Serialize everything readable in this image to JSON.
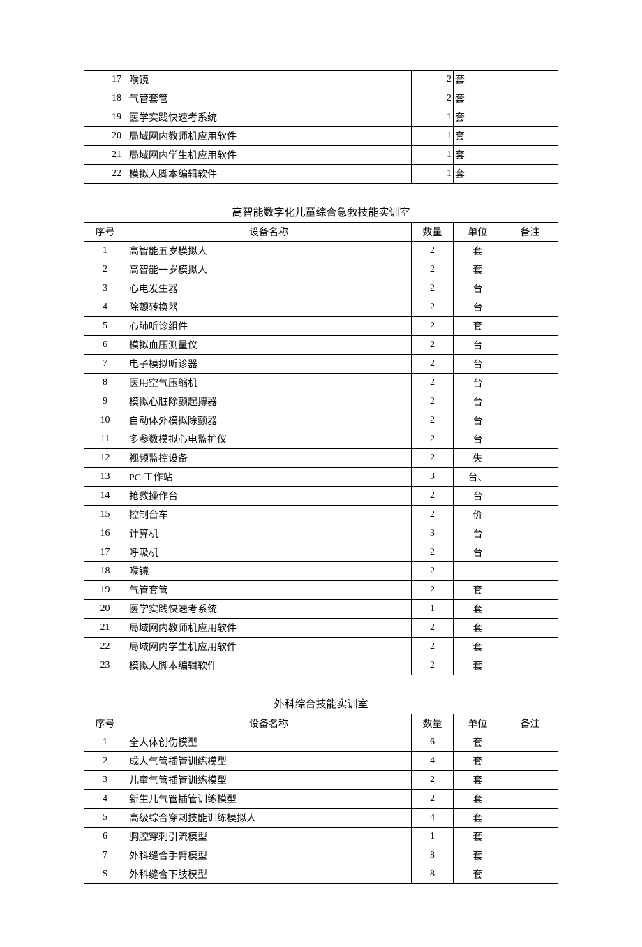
{
  "table1": {
    "rows": [
      {
        "seq": "17",
        "name": "喉镜",
        "qty": "2",
        "unit": "套",
        "note": ""
      },
      {
        "seq": "18",
        "name": "气管套管",
        "qty": "2",
        "unit": "套",
        "note": ""
      },
      {
        "seq": "19",
        "name": "医学实践快速考系统",
        "qty": "1",
        "unit": "套",
        "note": ""
      },
      {
        "seq": "20",
        "name": "局域网内教师机应用软件",
        "qty": "1",
        "unit": "套",
        "note": ""
      },
      {
        "seq": "21",
        "name": "局域网内学生机应用软件",
        "qty": "1",
        "unit": "套",
        "note": ""
      },
      {
        "seq": "22",
        "name": "模拟人脚本编辑软件",
        "qty": "1",
        "unit": "套",
        "note": ""
      }
    ]
  },
  "table2": {
    "title": "高智能数字化儿童综合急救技能实训室",
    "headers": {
      "seq": "序号",
      "name": "设备名称",
      "qty": "数量",
      "unit": "单位",
      "note": "备注"
    },
    "rows": [
      {
        "seq": "1",
        "name": "高智能五岁模拟人",
        "qty": "2",
        "unit": "套",
        "note": ""
      },
      {
        "seq": "2",
        "name": "高智能一岁模拟人",
        "qty": "2",
        "unit": "套",
        "note": ""
      },
      {
        "seq": "3",
        "name": "心电发生器",
        "qty": "2",
        "unit": "台",
        "note": ""
      },
      {
        "seq": "4",
        "name": "除颤转换器",
        "qty": "2",
        "unit": "台",
        "note": ""
      },
      {
        "seq": "5",
        "name": "心肺听诊组件",
        "qty": "2",
        "unit": "套",
        "note": ""
      },
      {
        "seq": "6",
        "name": "模拟血压测量仪",
        "qty": "2",
        "unit": "台",
        "note": ""
      },
      {
        "seq": "7",
        "name": "电子模拟听诊器",
        "qty": "2",
        "unit": "台",
        "note": ""
      },
      {
        "seq": "8",
        "name": "医用空气压缩机",
        "qty": "2",
        "unit": "台",
        "note": ""
      },
      {
        "seq": "9",
        "name": "模拟心脏除颤起搏器",
        "qty": "2",
        "unit": "台",
        "note": ""
      },
      {
        "seq": "10",
        "name": "自动体外模拟除颤器",
        "qty": "2",
        "unit": "台",
        "note": ""
      },
      {
        "seq": "11",
        "name": "多参数模拟心电监护仪",
        "qty": "2",
        "unit": "台",
        "note": ""
      },
      {
        "seq": "12",
        "name": "视频监控设备",
        "qty": "2",
        "unit": "失",
        "note": ""
      },
      {
        "seq": "13",
        "name": "PC 工作站",
        "qty": "3",
        "unit": "台、",
        "note": ""
      },
      {
        "seq": "14",
        "name": "抢救操作台",
        "qty": "2",
        "unit": "台",
        "note": ""
      },
      {
        "seq": "15",
        "name": "控制台车",
        "qty": "2",
        "unit": "价",
        "note": ""
      },
      {
        "seq": "16",
        "name": "计算机",
        "qty": "3",
        "unit": "台",
        "note": ""
      },
      {
        "seq": "17",
        "name": "呼吸机",
        "qty": "2",
        "unit": "台",
        "note": ""
      },
      {
        "seq": "18",
        "name": "喉镜",
        "qty": "2",
        "unit": "",
        "note": ""
      },
      {
        "seq": "19",
        "name": "气管套管",
        "qty": "2",
        "unit": "套",
        "note": ""
      },
      {
        "seq": "20",
        "name": "医学实践快速考系统",
        "qty": "1",
        "unit": "套",
        "note": ""
      },
      {
        "seq": "21",
        "name": "局域网内教师机应用软件",
        "qty": "2",
        "unit": "套",
        "note": ""
      },
      {
        "seq": "22",
        "name": "局域网内学生机应用软件",
        "qty": "2",
        "unit": "套",
        "note": ""
      },
      {
        "seq": "23",
        "name": "模拟人脚本编辑软件",
        "qty": "2",
        "unit": "套",
        "note": ""
      }
    ]
  },
  "table3": {
    "title": "外科综合技能实训室",
    "headers": {
      "seq": "序号",
      "name": "设备名称",
      "qty": "数量",
      "unit": "单位",
      "note": "备注"
    },
    "rows": [
      {
        "seq": "1",
        "name": "全人体创伤模型",
        "qty": "6",
        "unit": "套",
        "note": ""
      },
      {
        "seq": "2",
        "name": "成人气管插管训练模型",
        "qty": "4",
        "unit": "套",
        "note": ""
      },
      {
        "seq": "3",
        "name": "儿童气管插管训练模型",
        "qty": "2",
        "unit": "套",
        "note": ""
      },
      {
        "seq": "4",
        "name": "新生儿气管插管训练模型",
        "qty": "2",
        "unit": "套",
        "note": ""
      },
      {
        "seq": "5",
        "name": "高级综合穿刺技能训练模拟人",
        "qty": "4",
        "unit": "套",
        "note": ""
      },
      {
        "seq": "6",
        "name": "胸腔穿刺引流模型",
        "qty": "1",
        "unit": "套",
        "note": ""
      },
      {
        "seq": "7",
        "name": "外科缝合手臂模型",
        "qty": "8",
        "unit": "套",
        "note": ""
      },
      {
        "seq": "S",
        "name": "外科缝合下肢模型",
        "qty": "8",
        "unit": "套",
        "note": ""
      }
    ]
  }
}
